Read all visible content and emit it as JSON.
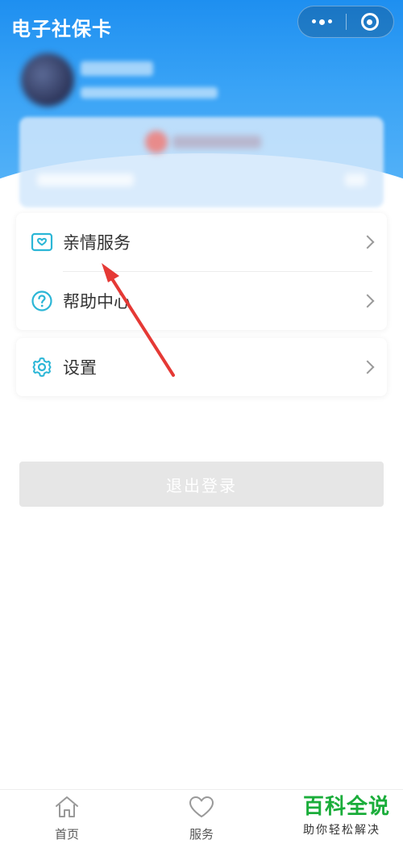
{
  "header": {
    "title": "电子社保卡"
  },
  "menu": {
    "group1": [
      {
        "label": "亲情服务",
        "icon": "family-card-icon"
      },
      {
        "label": "帮助中心",
        "icon": "help-circle-icon"
      }
    ],
    "group2": [
      {
        "label": "设置",
        "icon": "gear-icon"
      }
    ]
  },
  "logout": {
    "label": "退出登录"
  },
  "tabbar": {
    "items": [
      {
        "label": "首页",
        "icon": "home-icon"
      },
      {
        "label": "服务",
        "icon": "heart-icon"
      }
    ]
  },
  "watermark": {
    "title": "百科全说",
    "subtitle": "助你轻松解决"
  },
  "colors": {
    "header_blue": "#1e8ff0",
    "icon_teal": "#2bb6d6",
    "annotation_arrow": "#e53935",
    "watermark_green": "#1aad3a"
  }
}
